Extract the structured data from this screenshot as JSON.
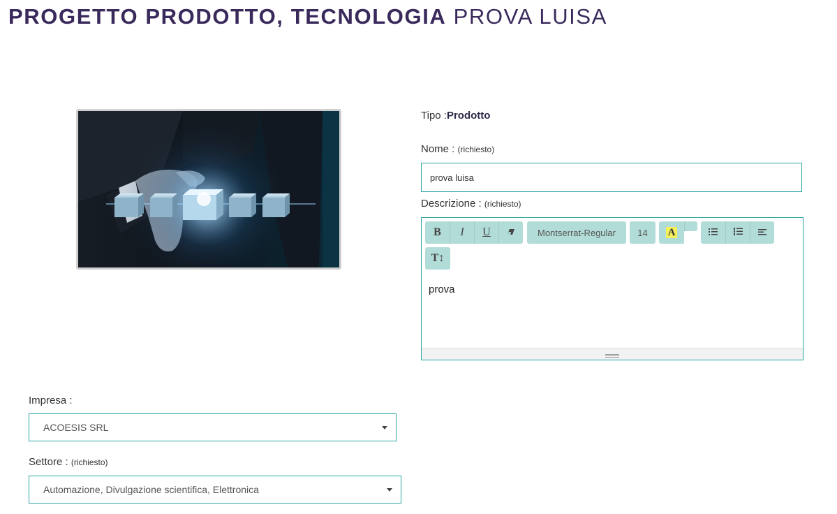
{
  "header": {
    "title_main": "PROGETTO PRODOTTO, TECNOLOGIA",
    "title_name": "PROVA LUISA"
  },
  "form": {
    "tipo_label": "Tipo :",
    "tipo_value": "Prodotto",
    "nome_label": "Nome :",
    "nome_required": "(richiesto)",
    "nome_value": "prova luisa",
    "descrizione_label": "Descrizione :",
    "descrizione_required": "(richiesto)",
    "descrizione_value": "prova",
    "impresa_label": "Impresa :",
    "impresa_value": "ACOESIS SRL",
    "settore_label": "Settore :",
    "settore_required": "(richiesto)",
    "settore_value": "Automazione, Divulgazione scientifica, Elettronica"
  },
  "editor_toolbar": {
    "bold_label": "B",
    "italic_label": "I",
    "underline_label": "U",
    "eraser_icon": "eraser-icon",
    "font_name": "Montserrat-Regular",
    "font_size": "14",
    "highlight_label": "A",
    "unordered_list_icon": "unordered-list-icon",
    "ordered_list_icon": "ordered-list-icon",
    "align_icon": "align-left-icon",
    "line_height_label": "T↕"
  },
  "colors": {
    "title": "#3a2a5c",
    "accent_border": "#2ba3a3",
    "toolbar_button": "#b2dcd8",
    "highlight": "#f4f05a"
  }
}
